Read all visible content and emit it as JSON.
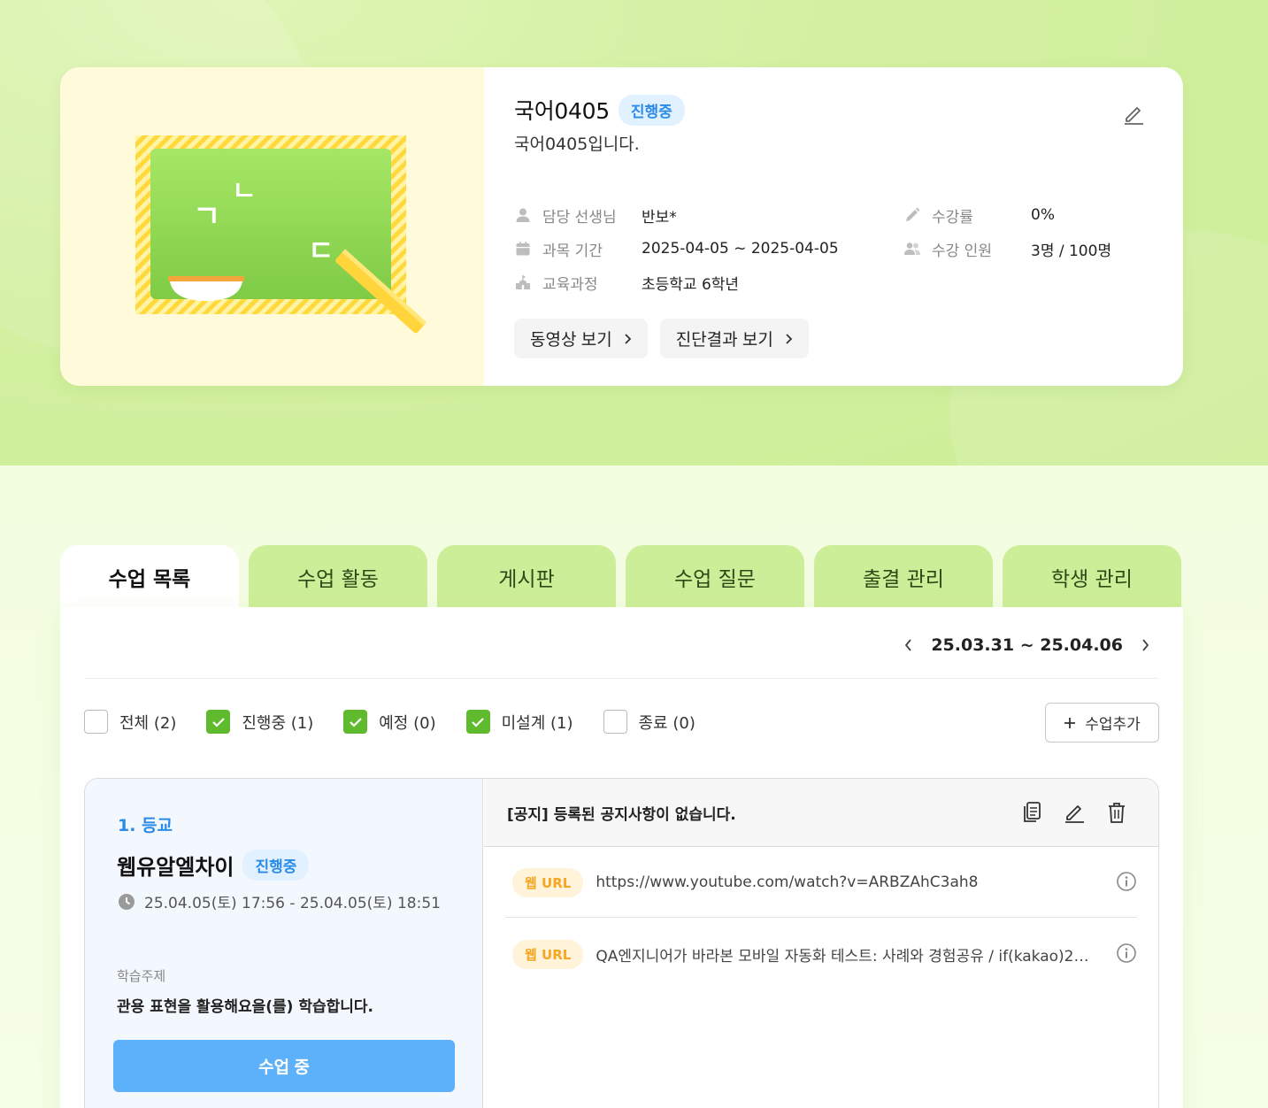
{
  "course": {
    "title": "국어0405",
    "status": "진행중",
    "description": "국어0405입니다.",
    "teacher_label": "담당 선생님",
    "teacher_value": "반보*",
    "period_label": "과목 기간",
    "period_value": "2025-04-05 ~ 2025-04-05",
    "curriculum_label": "교육과정",
    "curriculum_value": "초등학교 6학년",
    "progress_label": "수강률",
    "progress_value": "0%",
    "students_label": "수강 인원",
    "students_value": "3명 / 100명",
    "video_button": "동영상 보기",
    "diagnosis_button": "진단결과 보기",
    "board_chars": [
      "ㄱ",
      "ㄴ",
      "ㄷ"
    ]
  },
  "tabs": [
    {
      "label": "수업 목록",
      "active": true
    },
    {
      "label": "수업 활동",
      "active": false
    },
    {
      "label": "게시판",
      "active": false
    },
    {
      "label": "수업 질문",
      "active": false
    },
    {
      "label": "출결 관리",
      "active": false
    },
    {
      "label": "학생 관리",
      "active": false
    }
  ],
  "week_range": "25.03.31 ~ 25.04.06",
  "filters": [
    {
      "label": "전체 (2)",
      "checked": false
    },
    {
      "label": "진행중 (1)",
      "checked": true
    },
    {
      "label": "예정 (0)",
      "checked": true
    },
    {
      "label": "미설계 (1)",
      "checked": true
    },
    {
      "label": "종료 (0)",
      "checked": false
    }
  ],
  "add_button": "수업추가",
  "lesson": {
    "number": "1. 등교",
    "title": "웹유알엘차이",
    "status": "진행중",
    "time": "25.04.05(토) 17:56 - 25.04.05(토) 18:51",
    "topic_label": "학습주제",
    "topic_text": "관용 표현을 활용해요을(를) 학습합니다.",
    "action_button": "수업 중",
    "notice": "[공지] 등록된 공지사항이 없습니다.",
    "resources": [
      {
        "badge": "웹 URL",
        "text": "https://www.youtube.com/watch?v=ARBZAhC3ah8"
      },
      {
        "badge": "웹 URL",
        "text": "QA엔지니어가 바라본 모바일 자동화 테스트: 사례와 경험공유 / if(kakao)2…"
      }
    ]
  },
  "colors": {
    "accent_green": "#5fbb2d",
    "tab_green": "#cdee98",
    "badge_blue": "#2b8be6",
    "button_blue": "#5cb1fa",
    "url_badge_orange": "#f5a623"
  },
  "icons": {
    "edit": "pencil-icon",
    "teacher": "person-icon",
    "period": "calendar-icon",
    "curriculum": "school-icon",
    "progress": "pencil-icon",
    "students": "people-icon",
    "clock": "clock-icon",
    "copy": "document-copy-icon",
    "delete": "trash-icon",
    "info": "info-icon"
  }
}
